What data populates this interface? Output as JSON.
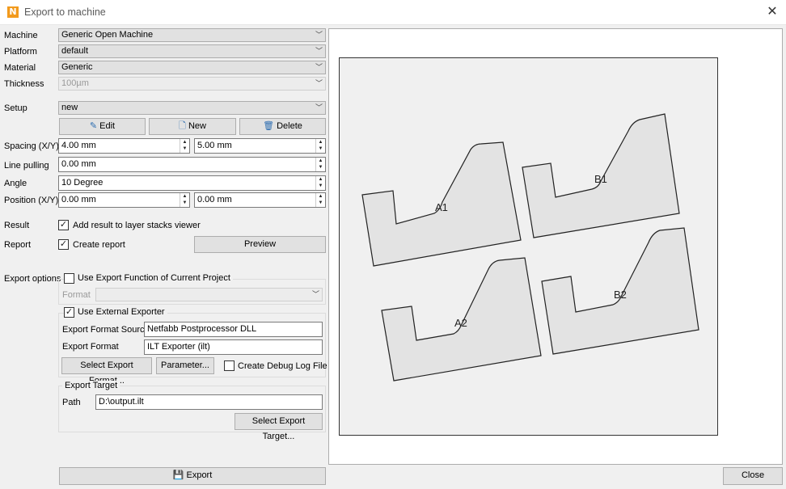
{
  "window": {
    "title": "Export to machine",
    "app_icon_letter": "N"
  },
  "form": {
    "machine": {
      "label": "Machine",
      "value": "Generic Open Machine"
    },
    "platform": {
      "label": "Platform",
      "value": "default"
    },
    "material": {
      "label": "Material",
      "value": "Generic"
    },
    "thickness": {
      "label": "Thickness",
      "value": "100µm"
    },
    "setup": {
      "label": "Setup",
      "value": "new"
    },
    "setup_buttons": {
      "edit": "Edit",
      "new": "New",
      "delete": "Delete"
    },
    "spacing": {
      "label": "Spacing (X/Y)",
      "x": "4.00 mm",
      "y": "5.00 mm"
    },
    "line_pulling": {
      "label": "Line pulling",
      "value": "0.00 mm"
    },
    "angle": {
      "label": "Angle",
      "value": "10 Degree"
    },
    "position": {
      "label": "Position (X/Y)",
      "x": "0.00 mm",
      "y": "0.00 mm"
    },
    "result": {
      "label": "Result",
      "checkbox": "Add result to layer stacks viewer",
      "checked": true
    },
    "report": {
      "label": "Report",
      "checkbox": "Create report",
      "checked": true,
      "preview_button": "Preview"
    }
  },
  "export_options": {
    "label": "Export options",
    "use_project_function": {
      "label": "Use Export Function of Current Project",
      "checked": false
    },
    "format": {
      "label": "Format",
      "value": ""
    },
    "use_external": {
      "label": "Use External Exporter",
      "checked": true
    },
    "format_source": {
      "label": "Export Format Source",
      "value": "Netfabb Postprocessor DLL"
    },
    "export_format": {
      "label": "Export Format",
      "value": "ILT Exporter (ilt)"
    },
    "select_format_button": "Select Export Format...",
    "parameter_button": "Parameter...",
    "debug_log": {
      "label": "Create Debug Log File",
      "checked": false
    },
    "target": {
      "title": "Export Target",
      "path_label": "Path",
      "path": "D:\\output.ilt",
      "select_button": "Select Export Target..."
    }
  },
  "footer": {
    "export_button": "Export",
    "close_button": "Close"
  },
  "preview": {
    "parts": [
      "A1",
      "B1",
      "A2",
      "B2"
    ]
  },
  "icons": {
    "edit": "pencil-icon",
    "new": "new-document-icon",
    "delete": "trash-icon",
    "export": "save-disk-icon",
    "close": "close-icon"
  }
}
